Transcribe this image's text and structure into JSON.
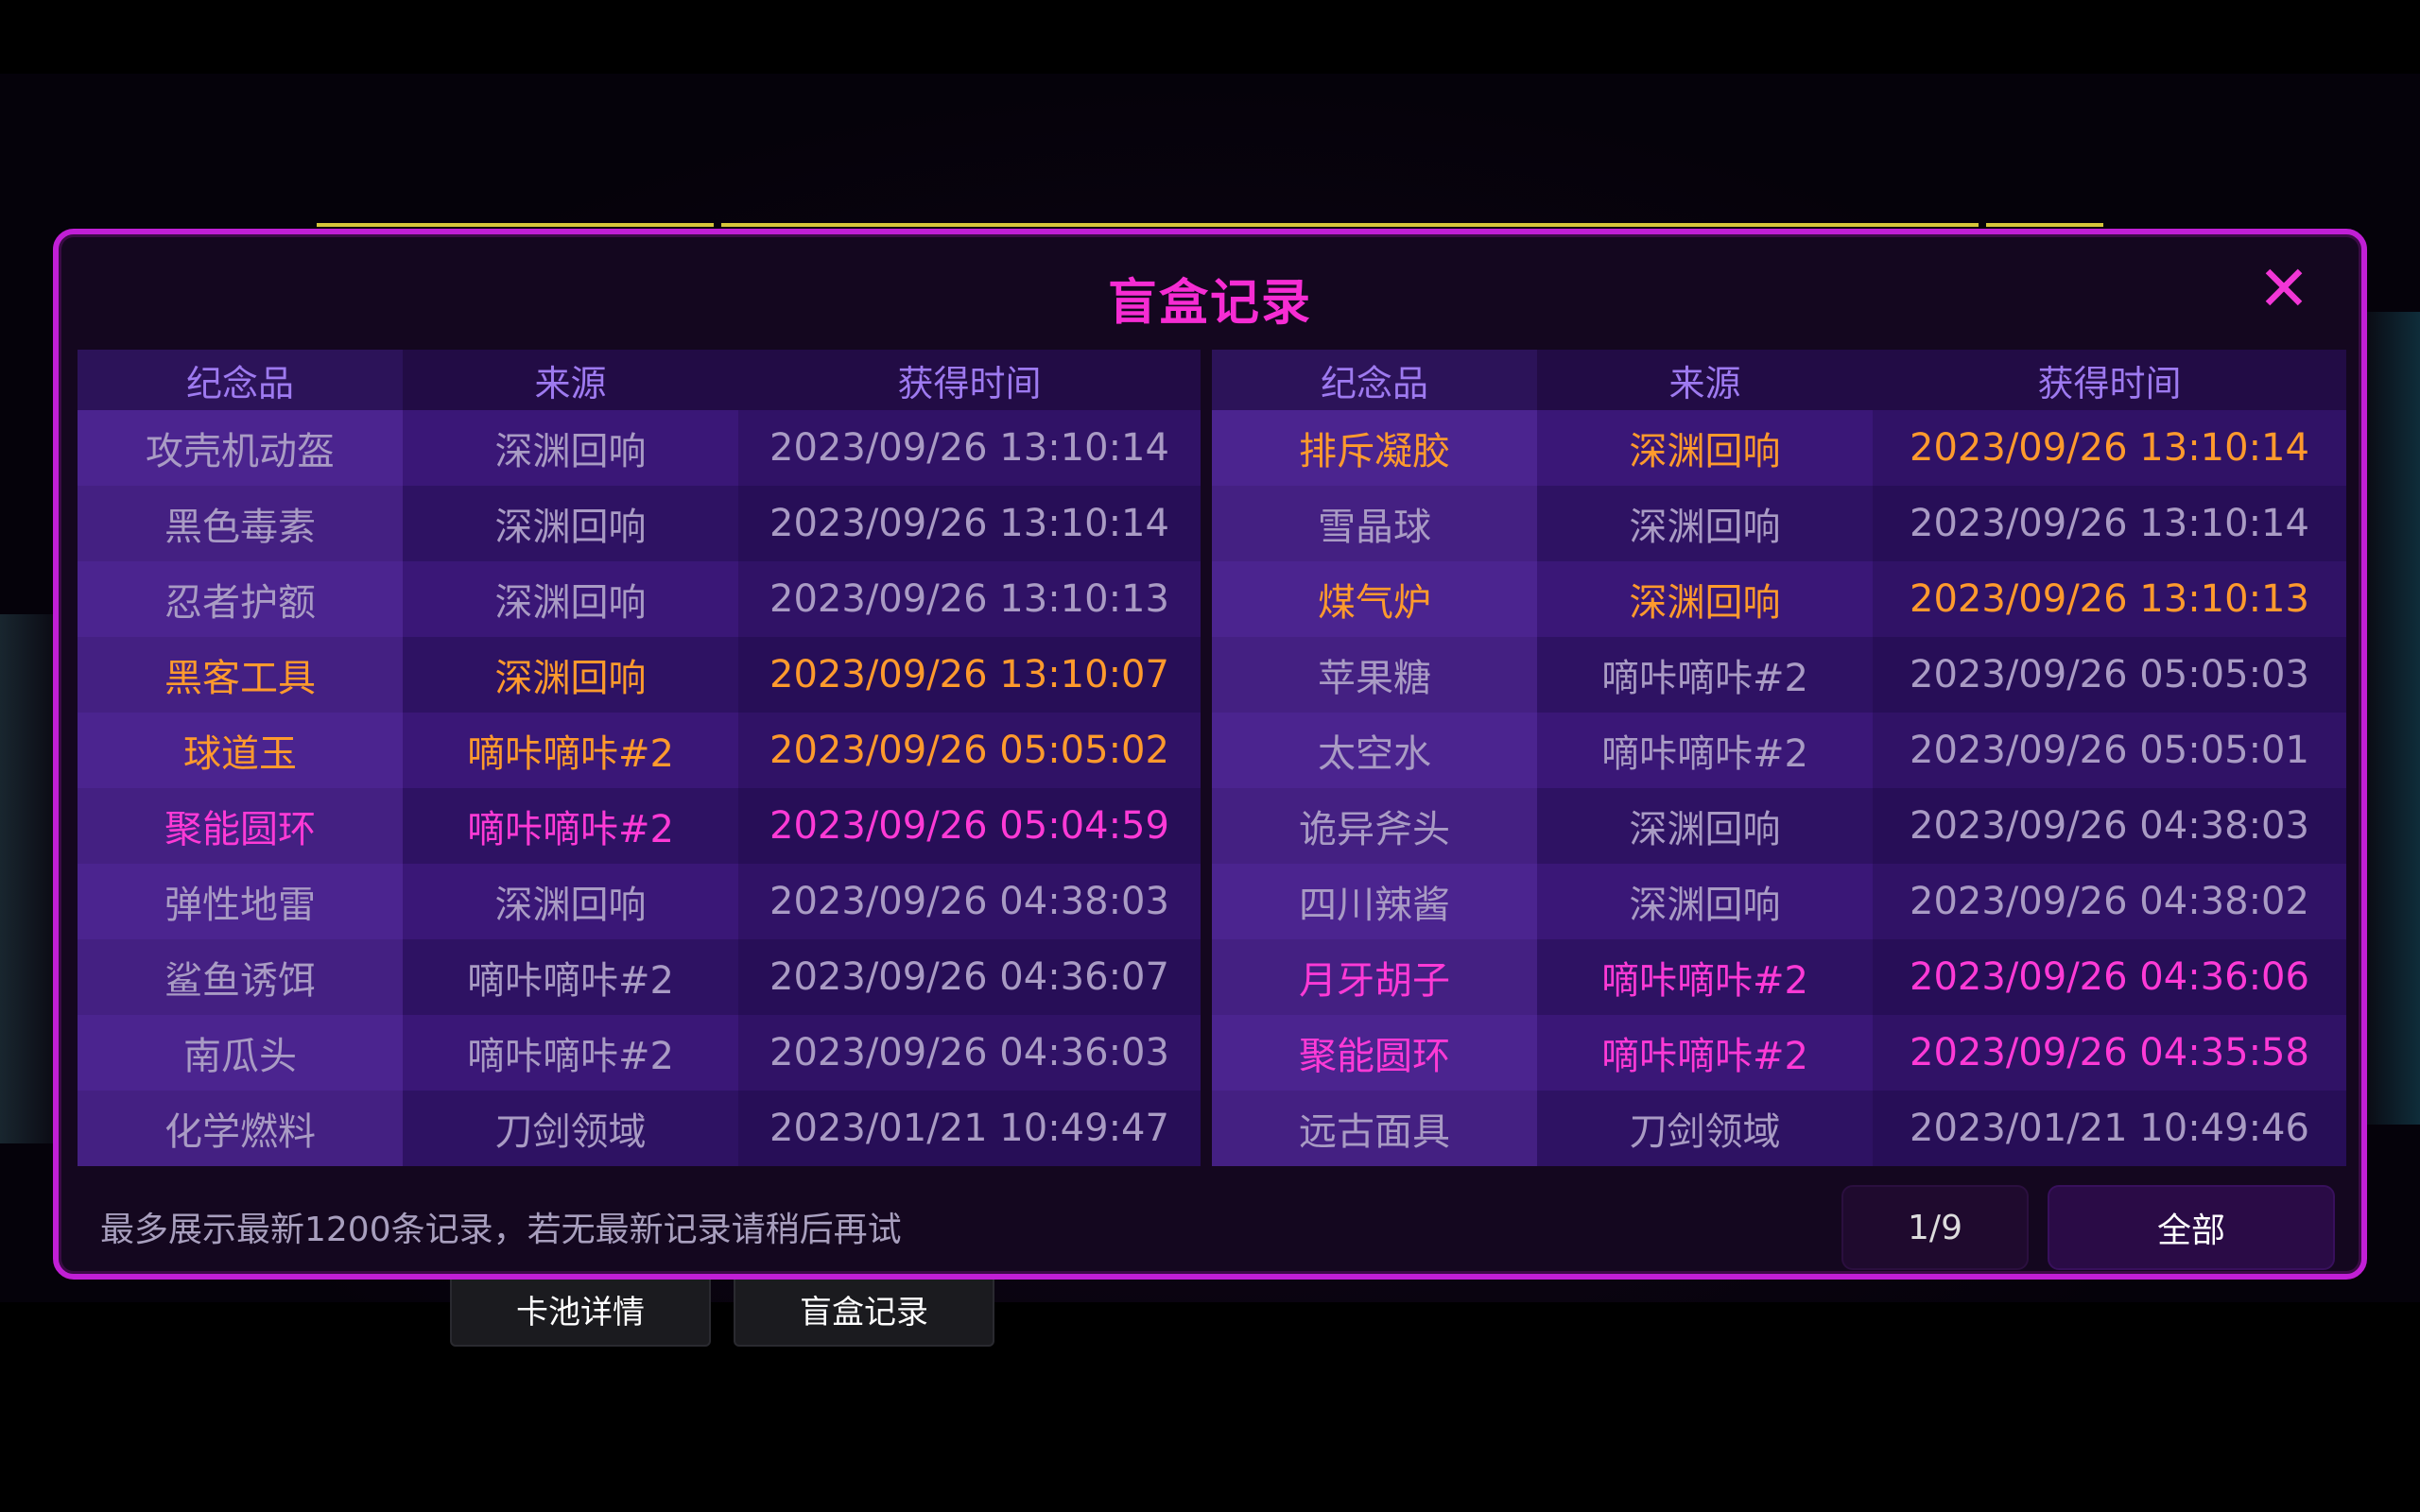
{
  "dialog": {
    "title": "盲盒记录",
    "close_icon": "close-icon",
    "columns": [
      "纪念品",
      "来源",
      "获得时间"
    ],
    "left_rows": [
      {
        "item": "攻壳机动盔",
        "source": "深渊回响",
        "time": "2023/09/26 13:10:14",
        "color": "grey"
      },
      {
        "item": "黑色毒素",
        "source": "深渊回响",
        "time": "2023/09/26 13:10:14",
        "color": "grey"
      },
      {
        "item": "忍者护额",
        "source": "深渊回响",
        "time": "2023/09/26 13:10:13",
        "color": "grey"
      },
      {
        "item": "黑客工具",
        "source": "深渊回响",
        "time": "2023/09/26 13:10:07",
        "color": "orange"
      },
      {
        "item": "球道玉",
        "source": "嘀咔嘀咔#2",
        "time": "2023/09/26 05:05:02",
        "color": "orange"
      },
      {
        "item": "聚能圆环",
        "source": "嘀咔嘀咔#2",
        "time": "2023/09/26 05:04:59",
        "color": "pink"
      },
      {
        "item": "弹性地雷",
        "source": "深渊回响",
        "time": "2023/09/26 04:38:03",
        "color": "grey"
      },
      {
        "item": "鲨鱼诱饵",
        "source": "嘀咔嘀咔#2",
        "time": "2023/09/26 04:36:07",
        "color": "grey"
      },
      {
        "item": "南瓜头",
        "source": "嘀咔嘀咔#2",
        "time": "2023/09/26 04:36:03",
        "color": "grey"
      },
      {
        "item": "化学燃料",
        "source": "刀剑领域",
        "time": "2023/01/21 10:49:47",
        "color": "grey"
      }
    ],
    "right_rows": [
      {
        "item": "排斥凝胶",
        "source": "深渊回响",
        "time": "2023/09/26 13:10:14",
        "color": "orange"
      },
      {
        "item": "雪晶球",
        "source": "深渊回响",
        "time": "2023/09/26 13:10:14",
        "color": "grey"
      },
      {
        "item": "煤气炉",
        "source": "深渊回响",
        "time": "2023/09/26 13:10:13",
        "color": "orange"
      },
      {
        "item": "苹果糖",
        "source": "嘀咔嘀咔#2",
        "time": "2023/09/26 05:05:03",
        "color": "grey"
      },
      {
        "item": "太空水",
        "source": "嘀咔嘀咔#2",
        "time": "2023/09/26 05:05:01",
        "color": "grey"
      },
      {
        "item": "诡异斧头",
        "source": "深渊回响",
        "time": "2023/09/26 04:38:03",
        "color": "grey"
      },
      {
        "item": "四川辣酱",
        "source": "深渊回响",
        "time": "2023/09/26 04:38:02",
        "color": "grey"
      },
      {
        "item": "月牙胡子",
        "source": "嘀咔嘀咔#2",
        "time": "2023/09/26 04:36:06",
        "color": "pink"
      },
      {
        "item": "聚能圆环",
        "source": "嘀咔嘀咔#2",
        "time": "2023/09/26 04:35:58",
        "color": "pink"
      },
      {
        "item": "远古面具",
        "source": "刀剑领域",
        "time": "2023/01/21 10:49:46",
        "color": "grey"
      }
    ],
    "footer_note": "最多展示最新1200条记录，若无最新记录请稍后再试",
    "page_indicator": "1/9",
    "filter_label": "全部"
  },
  "bottom_tabs": [
    "卡池详情",
    "盲盒记录"
  ],
  "colors": {
    "accent": "#c11fd6",
    "title": "#f62cd3",
    "orange": "#ff9a2d",
    "pink": "#ff3ad6",
    "grey": "#a99bc4"
  }
}
